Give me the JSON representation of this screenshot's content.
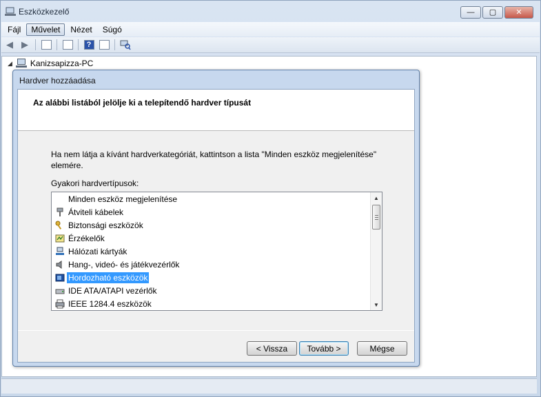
{
  "window": {
    "title": "Eszközkezelő",
    "min": "—",
    "max": "▢",
    "close": "✕"
  },
  "menu": {
    "items": [
      "Fájl",
      "Művelet",
      "Nézet",
      "Súgó"
    ]
  },
  "tree": {
    "root_label": "Kanizsapizza-PC"
  },
  "dialog": {
    "title": "Hardver hozzáadása",
    "heading": "Az alábbi listából jelölje ki a telepítendő hardver típusát",
    "description": "Ha nem látja a kívánt hardverkategóriát, kattintson a lista \"Minden eszköz megjelenítése\" elemére.",
    "list_label": "Gyakori hardvertípusok:",
    "list_items": [
      {
        "label": "Minden eszköz megjelenítése",
        "icon": "none"
      },
      {
        "label": "Átviteli kábelek",
        "icon": "cable-icon"
      },
      {
        "label": "Biztonsági eszközök",
        "icon": "key-icon"
      },
      {
        "label": "Érzékelők",
        "icon": "sensor-icon"
      },
      {
        "label": "Hálózati kártyák",
        "icon": "network-icon"
      },
      {
        "label": "Hang-, videó- és játékvezérlők",
        "icon": "speaker-icon"
      },
      {
        "label": "Hordozható eszközök",
        "icon": "portable-device-icon"
      },
      {
        "label": "IDE ATA/ATAPI vezérlők",
        "icon": "drive-icon"
      },
      {
        "label": "IEEE 1284.4 eszközök",
        "icon": "printer-icon"
      }
    ],
    "selected_item": "Hordozható eszközök",
    "buttons": {
      "back": "< Vissza",
      "next": "Tovább >",
      "cancel": "Mégse"
    }
  }
}
